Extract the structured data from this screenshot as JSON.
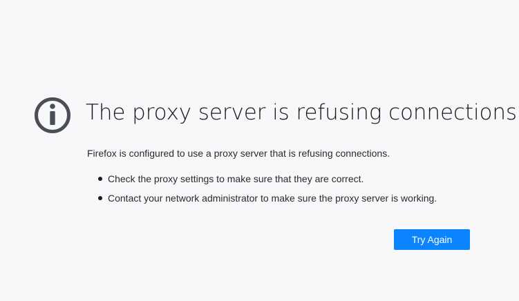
{
  "error_page": {
    "icon": "info-icon",
    "title": "The proxy server is refusing connections",
    "description": "Firefox is configured to use a proxy server that is refusing connections.",
    "suggestions": [
      "Check the proxy settings to make sure that they are correct.",
      "Contact your network administrator to make sure the proxy server is working."
    ],
    "try_again_label": "Try Again"
  },
  "colors": {
    "background": "#f8f8fa",
    "icon": "#4a4e57",
    "button": "#0a84ff",
    "button_text": "#ffffff"
  }
}
